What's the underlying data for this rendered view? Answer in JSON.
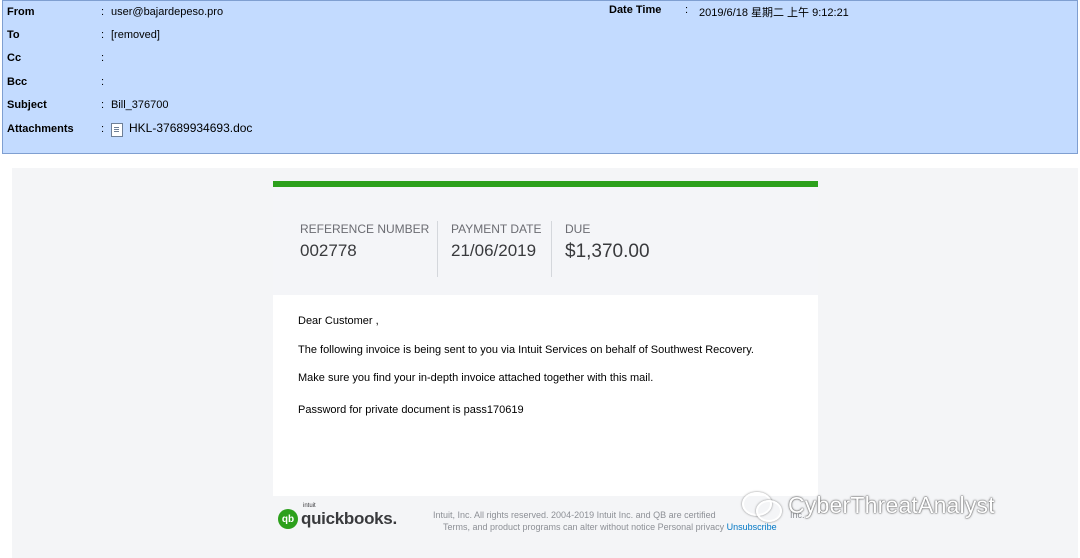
{
  "header": {
    "fields": [
      {
        "label": "From",
        "value": "user@bajardepeso.pro"
      },
      {
        "label": "To",
        "value": "[removed]"
      },
      {
        "label": "Cc",
        "value": ""
      },
      {
        "label": "Bcc",
        "value": ""
      },
      {
        "label": "Subject",
        "value": "Bill_376700"
      },
      {
        "label": "Attachments",
        "value": "HKL-37689934693.doc"
      }
    ],
    "date_label": "Date Time",
    "date_value": "2019/6/18 星期二 上午 9:12:21",
    "attachment_icon": "document-icon"
  },
  "invoice": {
    "accent_color": "#2ca01c",
    "reference_label": "REFERENCE NUMBER",
    "reference_value": "002778",
    "payment_date_label": "PAYMENT DATE",
    "payment_date_value": "21/06/2019",
    "due_label": "DUE",
    "due_value": "$1,370.00"
  },
  "message": {
    "greeting": "Dear Customer ,",
    "line1": "The following invoice is being sent to you via Intuit Services on behalf of Southwest Recovery.",
    "line2": "Make sure you find your in-depth invoice attached together with this mail.",
    "line3": "Password for private document  is pass170619"
  },
  "footer": {
    "logo_mark": "qb",
    "logo_intuit": "intuit",
    "logo_word": "quickbooks.",
    "legal_line1": "Intuit, Inc. All rights reserved. 2004-2019 Intuit Inc. and QB are certified",
    "legal_line1_tail": "Inc.",
    "legal_line2": "Terms,  and product programs can alter without notice  Personal privacy",
    "unsubscribe": "Unsubscribe"
  },
  "watermark": {
    "text": "CyberThreatAnalyst",
    "icon": "wechat-icon"
  }
}
